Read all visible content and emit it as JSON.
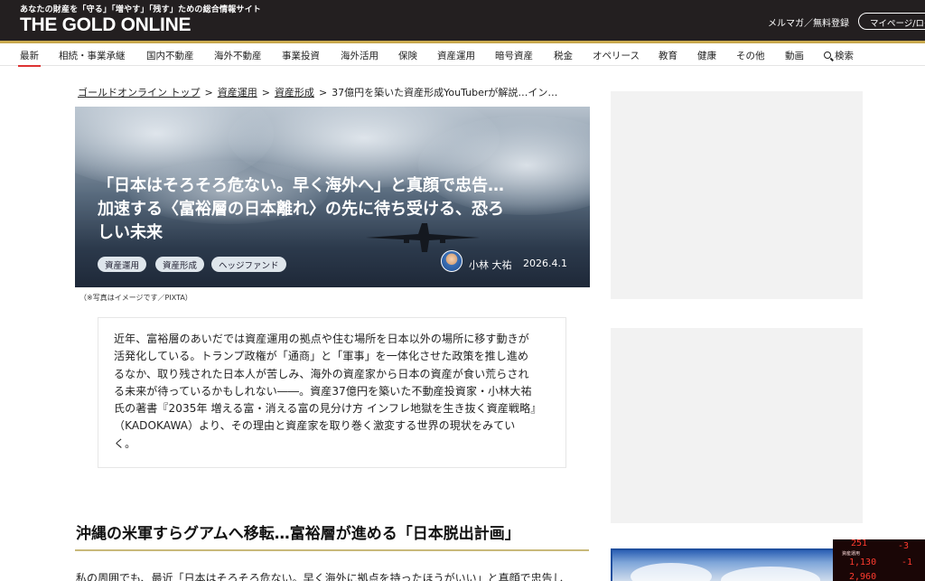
{
  "header": {
    "tagline": "あなたの財産を「守る」「増やす」「残す」ための総合情報サイト",
    "logo": "THE GOLD ONLINE",
    "mailmag": "メルマガ／無料登録",
    "mypage": "マイページ/ログイン"
  },
  "nav": {
    "items": [
      "最新",
      "相続・事業承継",
      "国内不動産",
      "海外不動産",
      "事業投資",
      "海外活用",
      "保険",
      "資産運用",
      "暗号資産",
      "税金",
      "オペリース",
      "教育",
      "健康",
      "その他",
      "動画"
    ],
    "search_label": "検索",
    "active_item": "最新"
  },
  "breadcrumb": {
    "items": [
      "ゴールドオンライン トップ",
      "資産運用",
      "資産形成"
    ],
    "current": "37億円を築いた資産形成YouTuberが解説…イン…",
    "separator": ">"
  },
  "article": {
    "title_lines": [
      "「日本はそろそろ危ない。早く海外へ」と真顔で忠告…",
      "加速する〈富裕層の日本離れ〉の先に待ち受ける、恐ろ",
      "しい未来"
    ],
    "tags": [
      "資産運用",
      "資産形成",
      "ヘッジファンド"
    ],
    "author": "小林 大祐",
    "date": "2026.4.1",
    "photo_caption": "（※写真はイメージです／PIXTA）",
    "summary_lines": [
      "近年、富裕層のあいだでは資産運用の拠点や住む場所を日本以外の場所に移す動きが",
      "活発化している。トランプ政権が「通商」と「軍事」を一体化させた政策を推し進め",
      "るなか、取り残された日本人が苦しみ、海外の資産家から日本の資産が食い荒らされ",
      "る未来が待っているかもしれない――。資産37億円を築いた不動産投資家・小林大祐",
      "氏の著書『2035年 増える富・消える富の見分け方 インフレ地獄を生き抜く資産戦略』",
      "（KADOKAWA）より、その理由と資産家を取り巻く激変する世界の現状をみてい",
      "く。"
    ],
    "heading": "沖縄の米軍すらグアムへ移転…富裕層が進める「日本脱出計画」",
    "body_first_line": "私の周囲でも、最近「日本はそろそろ危ない。早く海外に拠点を持ったほうがいい」と真顔で忠告し"
  },
  "sidebar": {
    "ticker": {
      "label": "資産運用",
      "values": [
        "251",
        "-3",
        "1,130",
        "-1",
        "2,960"
      ]
    }
  },
  "colors": {
    "header_bg": "#231f20",
    "gold_accent": "#c9a94e",
    "active_underline": "#dd3333",
    "heading_rule": "#c9b97a"
  }
}
